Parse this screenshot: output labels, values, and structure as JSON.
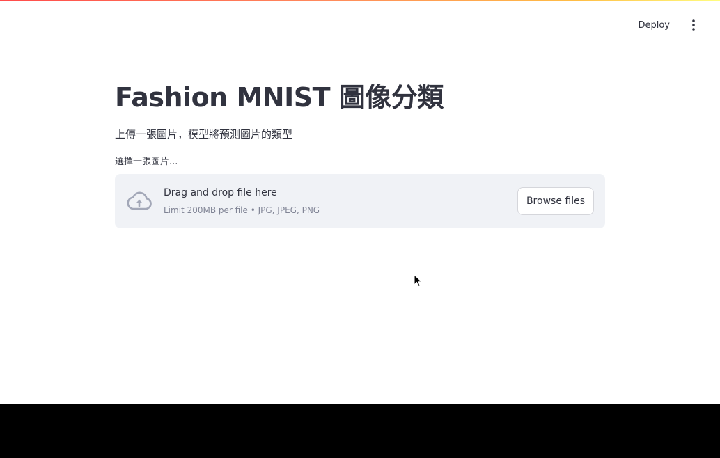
{
  "header": {
    "deploy_label": "Deploy",
    "menu_icon": "more-vertical-icon"
  },
  "main": {
    "title": "Fashion MNIST 圖像分類",
    "subtitle": "上傳一張圖片，模型將預測圖片的類型",
    "uploader": {
      "label": "選擇一張圖片...",
      "drop_text": "Drag and drop file here",
      "limit_text": "Limit 200MB per file • JPG, JPEG, PNG",
      "browse_label": "Browse files",
      "icon": "cloud-upload-icon"
    }
  },
  "colors": {
    "text": "#31333f",
    "muted": "#808495",
    "dropzone_bg": "#f0f2f6",
    "accent_gradient_start": "#ff4b4b",
    "accent_gradient_end": "#fffd80"
  }
}
